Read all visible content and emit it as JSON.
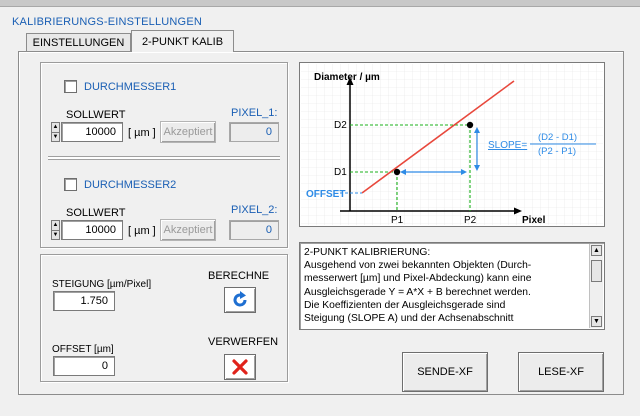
{
  "group_title": "KALIBRIERUNGS-EINSTELLUNGEN",
  "tabs": [
    {
      "label": "EINSTELLUNGEN",
      "active": false
    },
    {
      "label": "2-PUNKT KALIB",
      "active": true
    }
  ],
  "d1": {
    "checkbox_label": "DURCHMESSER1",
    "checked": false,
    "sollwert_label": "SOLLWERT",
    "value": "10000",
    "unit": "[ µm ]",
    "accept_label": "Akzeptiert",
    "pixel_label": "PIXEL_1:",
    "pixel_value": "0"
  },
  "d2": {
    "checkbox_label": "DURCHMESSER2",
    "checked": false,
    "sollwert_label": "SOLLWERT",
    "value": "10000",
    "unit": "[ µm ]",
    "accept_label": "Akzeptiert",
    "pixel_label": "PIXEL_2:",
    "pixel_value": "0"
  },
  "steigung": {
    "label": "STEIGUNG [µm/Pixel]",
    "value": "1.750"
  },
  "offset": {
    "label": "OFFSET  [µm]",
    "value": "0"
  },
  "berechne_label": "BERECHNE",
  "verwerfen_label": "VERWERFEN",
  "diagram": {
    "y_axis_label": "Diameter / µm",
    "x_axis_label": "Pixel",
    "d2": "D2",
    "d1": "D1",
    "offset": "OFFSET",
    "p1": "P1",
    "p2": "P2",
    "slope_label": "SLOPE=",
    "slope_num": "(D2 - D1)",
    "slope_den": "(P2 - P1)",
    "colors": {
      "line": "#e8483c",
      "guides": "#1bb21b",
      "accent": "#2e8be6"
    }
  },
  "info_lines": [
    "2-PUNKT KALIBRIERUNG:",
    "Ausgehend von zwei bekannten Objekten (Durch-",
    "messerwert [µm] und Pixel-Abdeckung) kann eine",
    "Ausgleichsgerade Y = A*X + B berechnet werden.",
    "Die Koeffizienten der Ausgleichsgerade sind",
    "Steigung (SLOPE A) und der Achsenabschnitt"
  ],
  "buttons": {
    "send": "SENDE-XF",
    "read": "LESE-XF"
  }
}
